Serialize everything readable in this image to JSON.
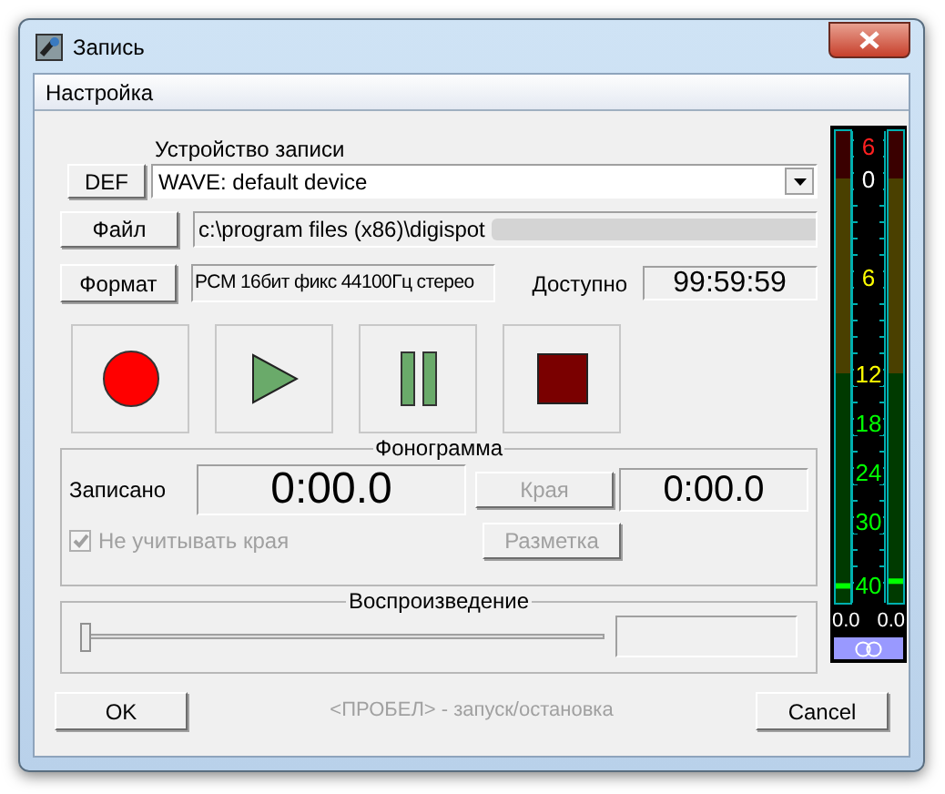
{
  "window": {
    "title": "Запись"
  },
  "tabs": [
    {
      "label": "Настройка",
      "selected": true
    }
  ],
  "device": {
    "label": "Устройство записи",
    "def_button": "DEF",
    "value": "WAVE: default device"
  },
  "file": {
    "button": "Файл",
    "value": "c:\\program files (x86)\\digispot"
  },
  "format": {
    "button": "Формат",
    "value": "PCM 16бит фикс 44100Гц стерео",
    "available_label": "Доступно",
    "available_value": "99:59:59"
  },
  "transport": [
    {
      "kind": "record"
    },
    {
      "kind": "play"
    },
    {
      "kind": "pause"
    },
    {
      "kind": "stop"
    }
  ],
  "phonogram": {
    "title": "Фонограмма",
    "recorded_label": "Записано",
    "recorded_value": "0:00.0",
    "edges_button": {
      "label": "Края",
      "disabled": true
    },
    "edges_value": "0:00.0",
    "ignore_edges": {
      "label": "Не учитывать края",
      "checked": true,
      "disabled": true
    },
    "markup_button": {
      "label": "Разметка",
      "disabled": true
    }
  },
  "playback": {
    "title": "Воспроизведение",
    "level": 0
  },
  "meter": {
    "scale": [
      {
        "label": "6",
        "color": "#ff2020"
      },
      {
        "label": "0",
        "color": "#ffffff"
      },
      {
        "label": "6",
        "color": "#ffff00"
      },
      {
        "label": "12",
        "color": "#ffff00"
      },
      {
        "label": "18",
        "color": "#00ff00"
      },
      {
        "label": "24",
        "color": "#00ff00"
      },
      {
        "label": "30",
        "color": "#00ff00"
      },
      {
        "label": "40",
        "color": "#00ff00"
      }
    ],
    "channels": [
      {
        "level": 0.03,
        "reading": "0.0"
      },
      {
        "level": 0.04,
        "reading": "0.0"
      }
    ]
  },
  "buttons": [
    {
      "label": "OK"
    },
    {
      "label": "Cancel"
    }
  ],
  "hint": "<ПРОБЕЛ> - запуск/остановка"
}
